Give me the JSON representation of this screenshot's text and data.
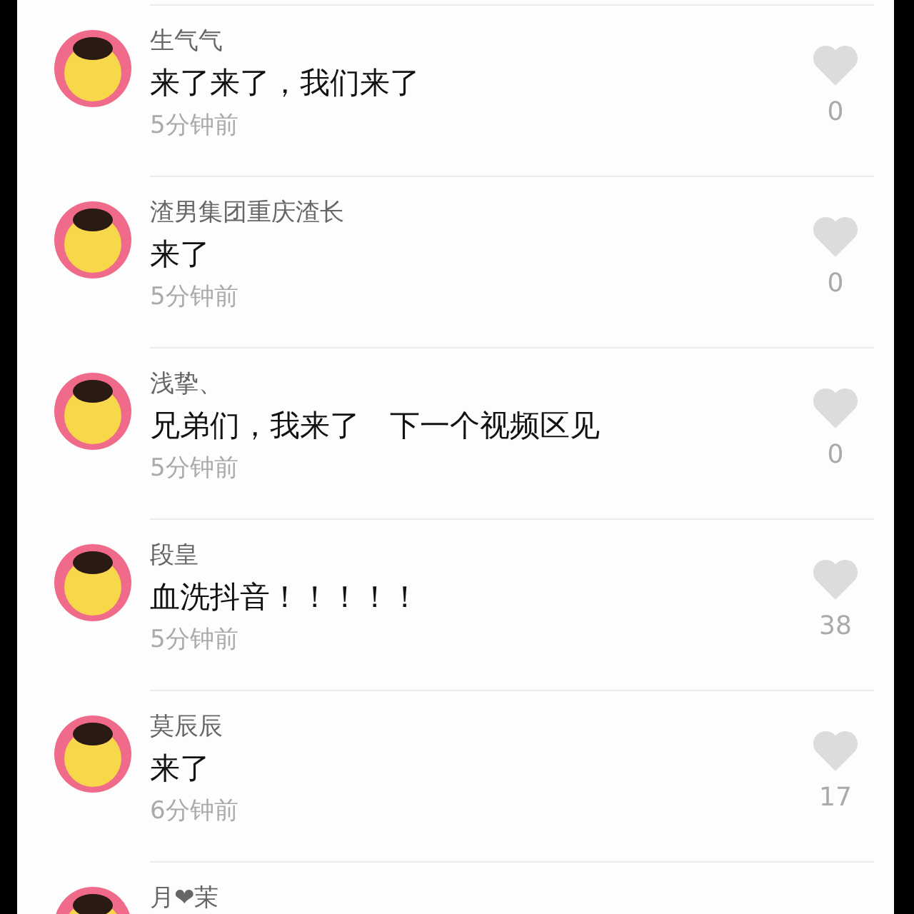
{
  "comments": [
    {
      "name": "生气气",
      "text": "来了来了，我们来了",
      "time": "5分钟前",
      "likes": "0"
    },
    {
      "name": "渣男集团重庆渣长",
      "text": "来了",
      "time": "5分钟前",
      "likes": "0"
    },
    {
      "name": "浅挚、",
      "text": "兄弟们，我来了　下一个视频区见",
      "time": "5分钟前",
      "likes": "0"
    },
    {
      "name": "段皇",
      "text": "血洗抖音！！！！！",
      "time": "5分钟前",
      "likes": "38"
    },
    {
      "name": "莫辰辰",
      "text": "来了",
      "time": "6分钟前",
      "likes": "17"
    },
    {
      "name": "月❤茉"
    }
  ]
}
